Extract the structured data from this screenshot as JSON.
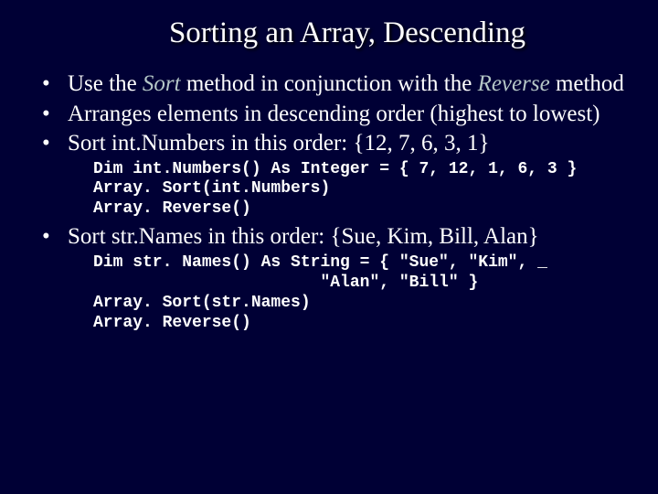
{
  "title": "Sorting an Array, Descending",
  "bullets": {
    "b1_pre": "Use the ",
    "b1_em1": "Sort",
    "b1_mid": " method in conjunction with the ",
    "b1_em2": "Reverse",
    "b1_post": " method",
    "b2": "Arranges elements in descending order (highest to lowest)",
    "b3": "Sort int.Numbers in this order: {12, 7, 6, 3, 1}",
    "b4": "Sort str.Names in this order: {Sue, Kim, Bill, Alan}"
  },
  "code1": "Dim int.Numbers() As Integer = { 7, 12, 1, 6, 3 }\nArray. Sort(int.Numbers)\nArray. Reverse()",
  "code2": "Dim str. Names() As String = { \"Sue\", \"Kim\", _\n                       \"Alan\", \"Bill\" }\nArray. Sort(str.Names)\nArray. Reverse()"
}
